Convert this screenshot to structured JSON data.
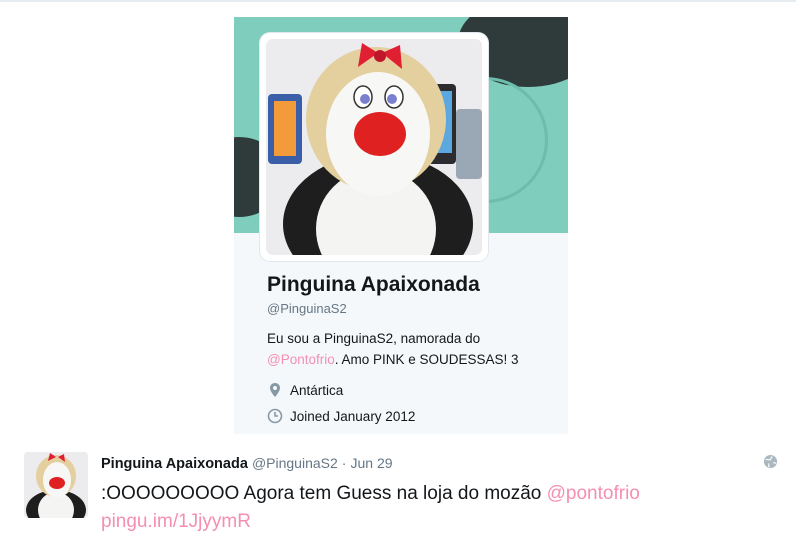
{
  "profile": {
    "name": "Pinguina Apaixonada",
    "handle": "@PinguinaS2",
    "bio_text_1": "Eu sou a PinguinaS2, namorada do",
    "bio_mention": "@Pontofrio",
    "bio_text_2": ". Amo PINK e SOUDESSAS! 3",
    "location": "Antártica",
    "joined": "Joined January 2012",
    "icons": {
      "location": "map-pin-icon",
      "joined": "clock-icon"
    },
    "colors": {
      "banner": "#7ecdbd",
      "accent": "#f48fb1"
    }
  },
  "tweet": {
    "name": "Pinguina Apaixonada",
    "handle": "@PinguinaS2",
    "separator": "·",
    "date": "Jun 29",
    "text": ":OOOOOOOOO Agora tem Guess na loja do mozão",
    "mention": "@pontofrio",
    "link": "pingu.im/1JjyymR",
    "icons": {
      "privacy": "globe-icon"
    }
  }
}
